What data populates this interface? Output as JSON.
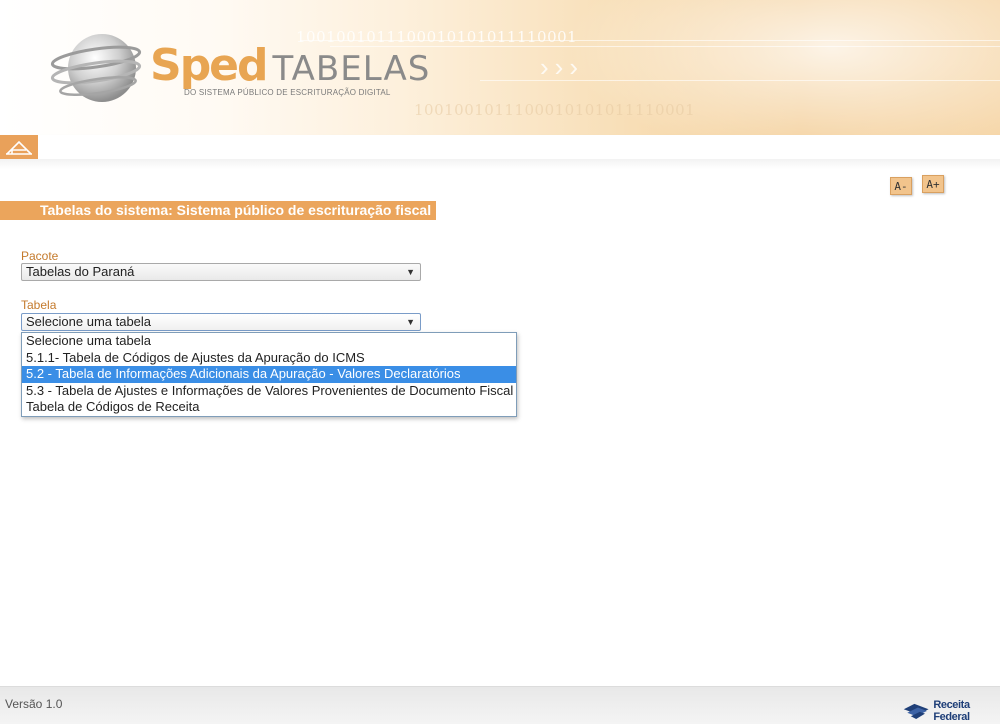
{
  "header": {
    "logo_sped": "Sped",
    "logo_tabelas": "TABELAS",
    "logo_subtitle": "DO SISTEMA PÚBLICO DE ESCRITURAÇÃO DIGITAL",
    "binary_top": "1001001011100010101011110001",
    "binary_bottom": "1001001011100010101011110001"
  },
  "nav": {
    "home_icon": "home-icon"
  },
  "font_controls": {
    "decrease_label": "A-",
    "increase_label": "A+"
  },
  "section": {
    "title": "Tabelas do sistema: Sistema público de escrituração fiscal"
  },
  "form": {
    "pacote": {
      "label": "Pacote",
      "value": "Tabelas do Paraná"
    },
    "tabela": {
      "label": "Tabela",
      "value": "Selecione uma tabela",
      "options": [
        "Selecione uma tabela",
        "5.1.1- Tabela de Códigos de Ajustes da Apuração do ICMS",
        "5.2 - Tabela de Informações Adicionais da Apuração - Valores Declaratórios",
        "5.3 - Tabela de Ajustes e Informações de Valores Provenientes de Documento Fiscal",
        "Tabela de Códigos de Receita"
      ],
      "highlighted_index": 2
    }
  },
  "footer": {
    "version": "Versão 1.0",
    "brand": "Receita Federal"
  },
  "colors": {
    "accent": "#eba55c",
    "label": "#c47a2c",
    "highlight": "#3a8ee6"
  }
}
